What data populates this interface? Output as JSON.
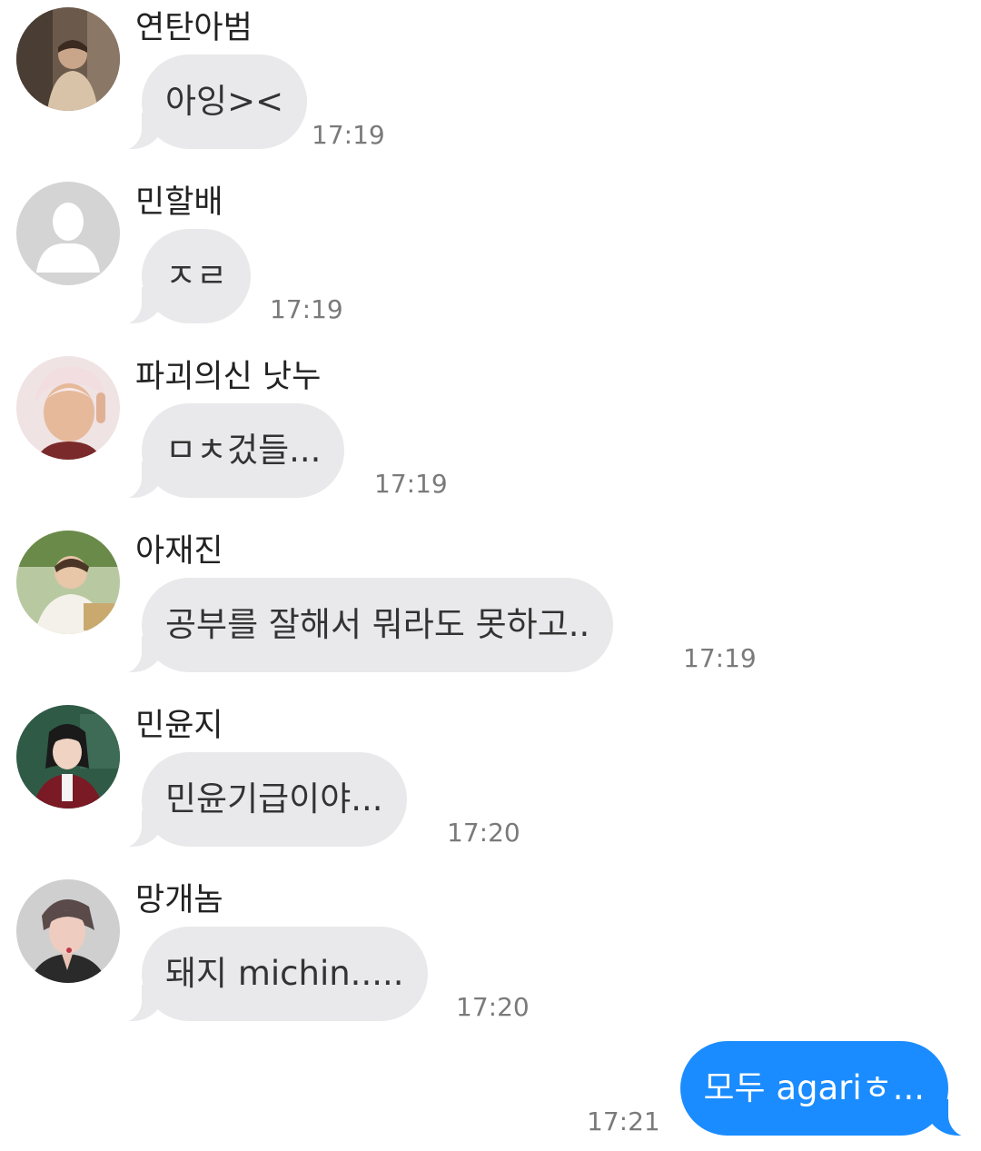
{
  "colors": {
    "incoming_bubble": "#e9e9eb",
    "outgoing_bubble": "#1a8cff",
    "timestamp": "#7a7a7a"
  },
  "messages": [
    {
      "sender": "연탄아범",
      "avatar": "photo-avatar",
      "text": "아잉><",
      "time": "17:19"
    },
    {
      "sender": "민할배",
      "avatar": "default-person-icon",
      "text": "ㅈㄹ",
      "time": "17:19"
    },
    {
      "sender": "파괴의신 낫누",
      "avatar": "photo-avatar",
      "text": "ㅁㅊ겄들...",
      "time": "17:19"
    },
    {
      "sender": "아재진",
      "avatar": "photo-avatar",
      "text": "공부를 잘해서 뭐라도 못하고..",
      "time": "17:19"
    },
    {
      "sender": "민윤지",
      "avatar": "photo-avatar",
      "text": "민윤기급이야...",
      "time": "17:20"
    },
    {
      "sender": "망개놈",
      "avatar": "photo-avatar",
      "text": "돼지 michin.....",
      "time": "17:20"
    }
  ],
  "outgoing": {
    "text": "모두 agariㅎ...",
    "time": "17:21"
  }
}
